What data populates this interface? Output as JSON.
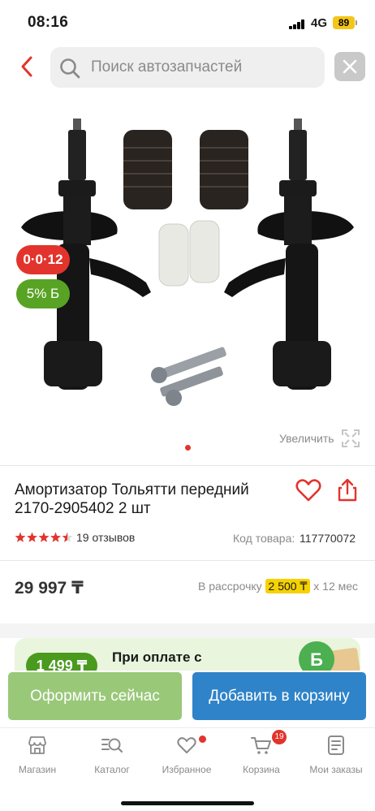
{
  "status_bar": {
    "time": "08:16",
    "network": "4G",
    "battery": "89"
  },
  "search": {
    "placeholder": "Поиск автозапчастей"
  },
  "gallery": {
    "discount_badge": "0·0·12",
    "bonus_badge": "5% Б",
    "zoom_label": "Увеличить"
  },
  "product": {
    "title_line1": "Амортизатор Тольятти передний",
    "title_line2": "2170-2905402 2 шт",
    "rating": 4.5,
    "reviews": "19 отзывов",
    "sku_label": "Код товара:",
    "sku": "117770072",
    "price": "29 997 ₸",
    "installment_prefix": "В рассрочку",
    "installment_amount": "2 500 ₸",
    "installment_suffix": "x 12 мес"
  },
  "promo": {
    "amount": "1 499 ₸",
    "text": "При оплате с"
  },
  "actions": {
    "order": "Оформить сейчас",
    "cart": "Добавить в корзину"
  },
  "tabs": [
    {
      "label": "Магазин",
      "icon": "shop-icon"
    },
    {
      "label": "Каталог",
      "icon": "catalog-search-icon"
    },
    {
      "label": "Избранное",
      "icon": "heart-icon"
    },
    {
      "label": "Корзина",
      "icon": "cart-icon",
      "count": "19"
    },
    {
      "label": "Мои заказы",
      "icon": "orders-icon"
    }
  ],
  "colors": {
    "accent_red": "#e2342d",
    "order_green": "#99c879",
    "cart_blue": "#2f83c8",
    "bonus_green": "#58a324"
  }
}
